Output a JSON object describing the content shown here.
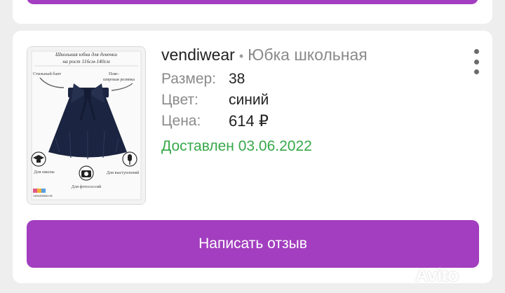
{
  "order": {
    "seller": "vendiwear",
    "separator": "•",
    "product_title": "Юбка школьная",
    "size_label": "Размер:",
    "size_value": "38",
    "color_label": "Цвет:",
    "color_value": "синий",
    "price_label": "Цена:",
    "price_value": "614 ₽",
    "status": "Доставлен 03.06.2022",
    "review_button": "Написать отзыв"
  },
  "thumbnail": {
    "heading_line1": "Школьная юбка для девочки",
    "heading_line2": "на рост 116см-140см",
    "note_bow": "Стильный бант",
    "note_belt_line1": "Пояс-",
    "note_belt_line2": "широкая резинка",
    "icon_school": "Для школы",
    "icon_photo": "Для фотосессий",
    "icon_stage": "Для выступлений",
    "brand": "VENDIWEAR"
  },
  "watermark": {
    "text": "Avito"
  },
  "colors": {
    "accent": "#a23ebf",
    "status_green": "#37a849",
    "skirt_navy": "#1b2440"
  },
  "icons": [
    "more-vertical-icon",
    "graduation-cap-icon",
    "camera-icon",
    "microphone-icon"
  ]
}
